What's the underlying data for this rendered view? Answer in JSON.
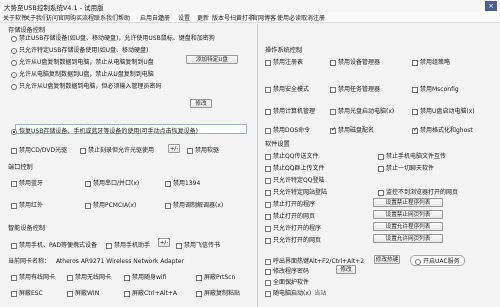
{
  "window": {
    "title": "大势至USB控制系统V4.1 - 试用版",
    "close_label": "×"
  },
  "menu": [
    "关于软件",
    "关于我们",
    "访问官网",
    "购买流程",
    "联系我们",
    "帮助",
    "启用自动",
    "注册",
    "设置",
    "更新",
    "版本号",
    "扫黄打非",
    "官网博客",
    "使用必读",
    "取消注册"
  ],
  "left": {
    "storage_title": "存储设备控制",
    "storage_options": [
      "禁止USB存储设备(如U盘、移动硬盘)，允许使用USB鼠标、键盘和加密狗",
      "只允许特定USB存储设备使用(如U盘、移动硬盘)",
      "允许从U盘复制数据到电脑，禁止从电脑复制到U盘",
      "允许从电脑复制数据到U盘，禁止从U盘复制到电脑",
      "只允许从U盘复制数据到电脑，但必须输入管理员密码",
      "恢复USB存储设备、手机或蓝牙等设备的使用(可手动点击恢复设备)"
    ],
    "add_udisk_btn": "添加特定U盘",
    "modify_btn": "修改",
    "cd_label": "禁用CD/DVD光驱",
    "cd_burn_label": "禁止刻录但允许光驱使用",
    "floppy_label": "禁用软驱",
    "plusminus": "+/-",
    "port_title": "端口控制",
    "ports": [
      "禁用蓝牙",
      "禁用串口/并口(x)",
      "禁用1394",
      "禁用红外",
      "禁用PCMCIA(x)",
      "禁用调制解调器(x)"
    ],
    "smart_title": "智能设备控制",
    "smart": [
      "禁用手机、PAD等便携式设备",
      "禁用手机助手",
      "禁用飞信传书"
    ],
    "nic_title": "当前网卡名称：",
    "nic_name": "Atheros AR9271 Wireless Network Adapter",
    "misc": [
      "禁用有线网卡",
      "禁用无线网卡",
      "禁用随身wifi",
      "屏蔽PrtScn",
      "屏蔽ESC",
      "屏蔽WIN",
      "屏蔽Ctrl+Alt+A",
      "屏蔽复制粘贴"
    ]
  },
  "right": {
    "os_title": "操作系统控制",
    "os": [
      "禁用注册表",
      "禁用设备管理器",
      "禁用组策略",
      "禁用安全模式",
      "禁用任务管理器",
      "禁用Msconfig",
      "禁用计算机管理",
      "禁用光盘启动电脑(x)",
      "禁用U盘启动电脑(x)",
      "禁用DOS命令",
      "禁用磁盘配名",
      "禁用格式化和ghost"
    ],
    "sw_title": "软件设置",
    "sw": [
      {
        "label": "禁止QQ传送文件",
        "right": "禁止手机电脑文件互传"
      },
      {
        "label": "禁止QQ群上传文件",
        "right": "禁止一切聊天软件"
      },
      {
        "label": "只允许特定QQ登陆",
        "right": ""
      },
      {
        "label": "只允许特定网站登陆",
        "right": "监控不到浏览器打开的网页"
      },
      {
        "label": "禁止打开的程序",
        "btn": "设置禁止程序列表"
      },
      {
        "label": "禁止打开的网页",
        "btn": "设置禁止网页列表"
      },
      {
        "label": "只允许打开的程序",
        "btn": "设置允许程序列表"
      },
      {
        "label": "只允许打开的网页",
        "btn": "设置允许网页列表"
      }
    ],
    "hotkey_label": "呼出界面热键Alt+F2/Ctrl+Alt+2",
    "hotkey_btn": "修改热键",
    "uac_label": "开启UAC服务",
    "pwd_label": "修改程序密码",
    "pwd_btn": "修改",
    "fullscreen_label": "全面保护软件",
    "autostart_label": "随电脑启动(x)",
    "autostart_suffix": "当站"
  }
}
